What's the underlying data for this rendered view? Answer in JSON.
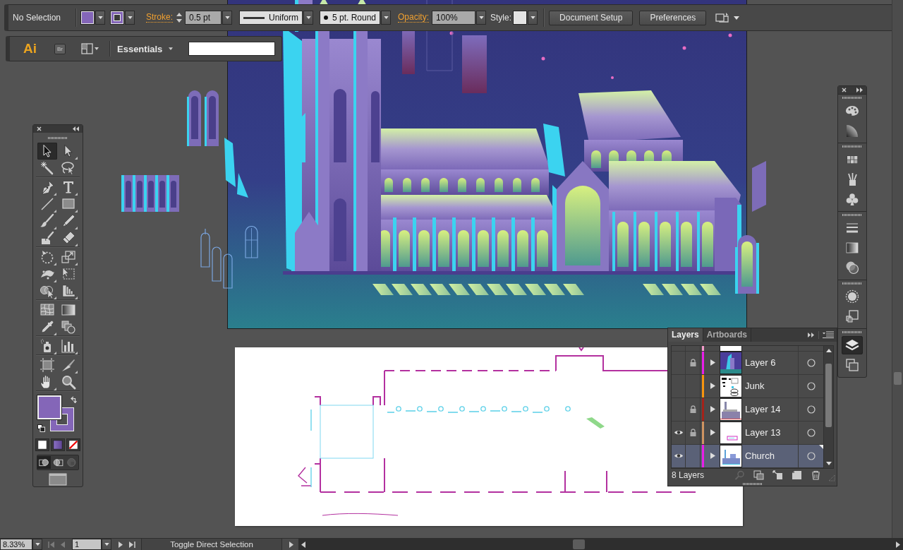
{
  "control_bar": {
    "selection": "No Selection",
    "fill": {
      "color": "#8466b8"
    },
    "stroke": {
      "color": "#8466b8"
    },
    "stroke_label": "Stroke:",
    "stroke_weight": "0.5 pt",
    "profile": "Uniform",
    "brush": "5 pt. Round",
    "opacity_label": "Opacity:",
    "opacity": "100%",
    "style_label": "Style:",
    "buttons": [
      "Document Setup",
      "Preferences"
    ]
  },
  "app_bar": {
    "logo": "Ai",
    "bridge": "Br",
    "workspace": "Essentials"
  },
  "tools": {
    "groups": [
      {
        "items": [
          {
            "kind": "selection",
            "selected": true
          },
          {
            "kind": "direct_selection",
            "selected": false
          },
          {
            "kind": "magic_wand",
            "selected": false
          },
          {
            "kind": "lasso",
            "selected": false
          }
        ]
      },
      {
        "items": [
          {
            "kind": "pen",
            "selected": false
          },
          {
            "kind": "type",
            "selected": false
          },
          {
            "kind": "line",
            "selected": false
          },
          {
            "kind": "rectangle",
            "selected": false
          },
          {
            "kind": "paintbrush",
            "selected": false
          },
          {
            "kind": "pencil",
            "selected": false
          },
          {
            "kind": "blob_brush",
            "selected": false
          },
          {
            "kind": "eraser",
            "selected": false
          }
        ]
      },
      {
        "items": [
          {
            "kind": "rotate",
            "selected": false
          },
          {
            "kind": "scale",
            "selected": false
          },
          {
            "kind": "width",
            "selected": false
          },
          {
            "kind": "free_transform",
            "selected": false
          },
          {
            "kind": "shape_builder",
            "selected": false
          },
          {
            "kind": "perspective_grid",
            "selected": false
          }
        ]
      },
      {
        "items": [
          {
            "kind": "mesh",
            "selected": false
          },
          {
            "kind": "gradient",
            "selected": false
          },
          {
            "kind": "eyedropper",
            "selected": false
          },
          {
            "kind": "blend",
            "selected": false
          }
        ]
      },
      {
        "items": [
          {
            "kind": "symbol_sprayer",
            "selected": false
          },
          {
            "kind": "column_graph",
            "selected": false
          }
        ]
      },
      {
        "items": [
          {
            "kind": "artboard",
            "selected": false
          },
          {
            "kind": "slice",
            "selected": false
          },
          {
            "kind": "hand",
            "selected": false
          },
          {
            "kind": "zoom",
            "selected": false
          }
        ]
      }
    ],
    "fill": {
      "color": "#8466b8"
    },
    "stroke": {
      "color": "#8466b8"
    },
    "color_modes": [
      {
        "kind": "color"
      },
      {
        "kind": "gradient"
      },
      {
        "kind": "none"
      }
    ],
    "draw_modes": [
      {
        "kind": "normal",
        "selected": true,
        "disabled": false
      },
      {
        "kind": "behind",
        "selected": false,
        "disabled": false
      },
      {
        "kind": "inside",
        "selected": false,
        "disabled": true
      }
    ]
  },
  "dock": {
    "groups": [
      {
        "items": [
          {
            "kind": "color",
            "selected": false
          },
          {
            "kind": "color_guide",
            "selected": false
          }
        ]
      },
      {
        "items": [
          {
            "kind": "swatches",
            "selected": false
          },
          {
            "kind": "brushes",
            "selected": false
          },
          {
            "kind": "symbols",
            "selected": false
          }
        ]
      },
      {
        "items": [
          {
            "kind": "stroke",
            "selected": false
          },
          {
            "kind": "gradient",
            "selected": false
          },
          {
            "kind": "transparency",
            "selected": false
          }
        ]
      },
      {
        "items": [
          {
            "kind": "appearance",
            "selected": false
          },
          {
            "kind": "graphic_styles",
            "selected": false
          }
        ]
      },
      {
        "items": [
          {
            "kind": "layers",
            "selected": true
          },
          {
            "kind": "artboards",
            "selected": false
          }
        ]
      }
    ]
  },
  "layers_panel": {
    "tabs": [
      {
        "label": "Layers",
        "selected": true
      },
      {
        "label": "Artboards",
        "selected": false
      }
    ],
    "rows": [
      {
        "color": "#f29bc9",
        "selected": false
      },
      {
        "name": "Layer 6",
        "color": "#e81ee8",
        "visible": false,
        "locked": true,
        "selected": false
      },
      {
        "name": "Junk",
        "color": "#f7950f",
        "visible": false,
        "locked": false,
        "selected": false
      },
      {
        "name": "Layer 14",
        "color": "#a5231a",
        "visible": false,
        "locked": true,
        "selected": false
      },
      {
        "name": "Layer 13",
        "color": "#cf9461",
        "visible": true,
        "locked": true,
        "selected": false
      },
      {
        "name": "Church",
        "color": "#e81ee8",
        "visible": true,
        "locked": false,
        "selected": true
      }
    ],
    "count": "8 Layers"
  },
  "status_bar": {
    "zoom": "8.33%",
    "artboard": "1",
    "status": "Toggle Direct Selection"
  }
}
